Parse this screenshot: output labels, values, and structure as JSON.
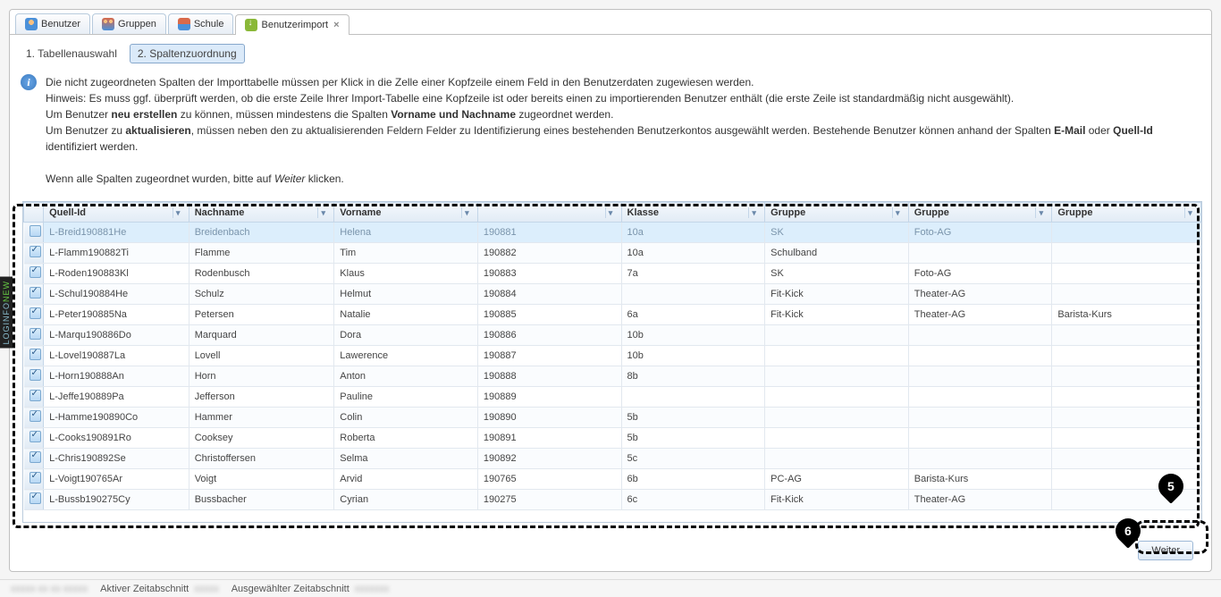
{
  "tabs": [
    {
      "label": "Benutzer",
      "icon": "user"
    },
    {
      "label": "Gruppen",
      "icon": "group"
    },
    {
      "label": "Schule",
      "icon": "school"
    },
    {
      "label": "Benutzerimport",
      "icon": "import",
      "active": true,
      "closable": true
    }
  ],
  "steps": [
    {
      "label": "1. Tabellenauswahl",
      "active": false
    },
    {
      "label": "2. Spaltenzuordnung",
      "active": true
    }
  ],
  "info": {
    "line1": "Die nicht zugeordneten Spalten der Importtabelle müssen per Klick in die Zelle einer Kopfzeile einem Feld in den Benutzerdaten zugewiesen werden.",
    "line2a": "Hinweis: Es muss ggf. überprüft werden, ob die erste Zeile Ihrer Import-Tabelle eine Kopfzeile ist oder bereits einen zu importierenden Benutzer enthält (die erste Zeile ist standardmäßig nicht ausgewählt).",
    "line3a": "Um Benutzer ",
    "line3b": "neu erstellen",
    "line3c": " zu können, müssen mindestens die Spalten ",
    "line3d": "Vorname und Nachname",
    "line3e": " zugeordnet werden.",
    "line4a": "Um Benutzer zu ",
    "line4b": "aktualisieren",
    "line4c": ", müssen neben den zu aktualisierenden Feldern Felder zu Identifizierung eines bestehenden Benutzerkontos ausgewählt werden. Bestehende Benutzer können anhand der Spalten ",
    "line4d": "E-Mail",
    "line4e": " oder ",
    "line4f": "Quell-Id",
    "line4g": " identifiziert werden.",
    "line5a": "Wenn alle Spalten zugeordnet wurden, bitte auf ",
    "line5b": "Weiter",
    "line5c": " klicken."
  },
  "columns": [
    "Quell-Id",
    "Nachname",
    "Vorname",
    "",
    "Klasse",
    "Gruppe",
    "Gruppe",
    "Gruppe"
  ],
  "rows": [
    {
      "checked": false,
      "first": true,
      "cells": [
        "L-Breid190881He",
        "Breidenbach",
        "Helena",
        "190881",
        "10a",
        "SK",
        "Foto-AG",
        ""
      ]
    },
    {
      "checked": true,
      "cells": [
        "L-Flamm190882Ti",
        "Flamme",
        "Tim",
        "190882",
        "10a",
        "Schulband",
        "",
        ""
      ]
    },
    {
      "checked": true,
      "cells": [
        "L-Roden190883Kl",
        "Rodenbusch",
        "Klaus",
        "190883",
        "7a",
        "SK",
        "Foto-AG",
        ""
      ]
    },
    {
      "checked": true,
      "cells": [
        "L-Schul190884He",
        "Schulz",
        "Helmut",
        "190884",
        "",
        "Fit-Kick",
        "Theater-AG",
        ""
      ]
    },
    {
      "checked": true,
      "cells": [
        "L-Peter190885Na",
        "Petersen",
        "Natalie",
        "190885",
        "6a",
        "Fit-Kick",
        "Theater-AG",
        "Barista-Kurs"
      ]
    },
    {
      "checked": true,
      "cells": [
        "L-Marqu190886Do",
        "Marquard",
        "Dora",
        "190886",
        "10b",
        "",
        "",
        ""
      ]
    },
    {
      "checked": true,
      "cells": [
        "L-Lovel190887La",
        "Lovell",
        "Lawerence",
        "190887",
        "10b",
        "",
        "",
        ""
      ]
    },
    {
      "checked": true,
      "cells": [
        "L-Horn190888An",
        "Horn",
        "Anton",
        "190888",
        "8b",
        "",
        "",
        ""
      ]
    },
    {
      "checked": true,
      "cells": [
        "L-Jeffe190889Pa",
        "Jefferson",
        "Pauline",
        "190889",
        "",
        "",
        "",
        ""
      ]
    },
    {
      "checked": true,
      "cells": [
        "L-Hamme190890Co",
        "Hammer",
        "Colin",
        "190890",
        "5b",
        "",
        "",
        ""
      ]
    },
    {
      "checked": true,
      "cells": [
        "L-Cooks190891Ro",
        "Cooksey",
        "Roberta",
        "190891",
        "5b",
        "",
        "",
        ""
      ]
    },
    {
      "checked": true,
      "cells": [
        "L-Chris190892Se",
        "Christoffersen",
        "Selma",
        "190892",
        "5c",
        "",
        "",
        ""
      ]
    },
    {
      "checked": true,
      "cells": [
        "L-Voigt190765Ar",
        "Voigt",
        "Arvid",
        "190765",
        "6b",
        "PC-AG",
        "Barista-Kurs",
        ""
      ]
    },
    {
      "checked": true,
      "cells": [
        "L-Bussb190275Cy",
        "Bussbacher",
        "Cyrian",
        "190275",
        "6c",
        "Fit-Kick",
        "Theater-AG",
        ""
      ]
    }
  ],
  "buttons": {
    "next": "Weiter"
  },
  "statusbar": {
    "active_label": "Aktiver Zeitabschnitt",
    "selected_label": "Ausgewählter Zeitabschnitt"
  },
  "callouts": {
    "c5": "5",
    "c6": "6"
  },
  "side_tag": {
    "a": "LOGINFO",
    "b": "NEW"
  }
}
